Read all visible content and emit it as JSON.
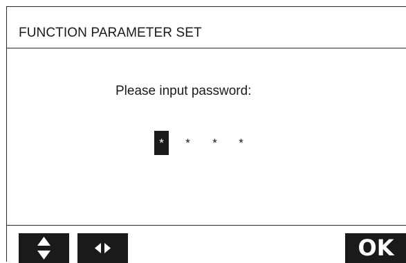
{
  "header": {
    "title": "FUNCTION PARAMETER SET"
  },
  "main": {
    "prompt": "Please input password:",
    "password": {
      "slots": [
        "*",
        "*",
        "*",
        "*"
      ],
      "active_index": 0
    }
  },
  "footer": {
    "updown_icon": "up-down-arrows-icon",
    "leftright_icon": "left-right-arrows-icon",
    "ok_label": "OK"
  },
  "colors": {
    "foreground": "#1a1a1a",
    "background": "#ffffff"
  }
}
